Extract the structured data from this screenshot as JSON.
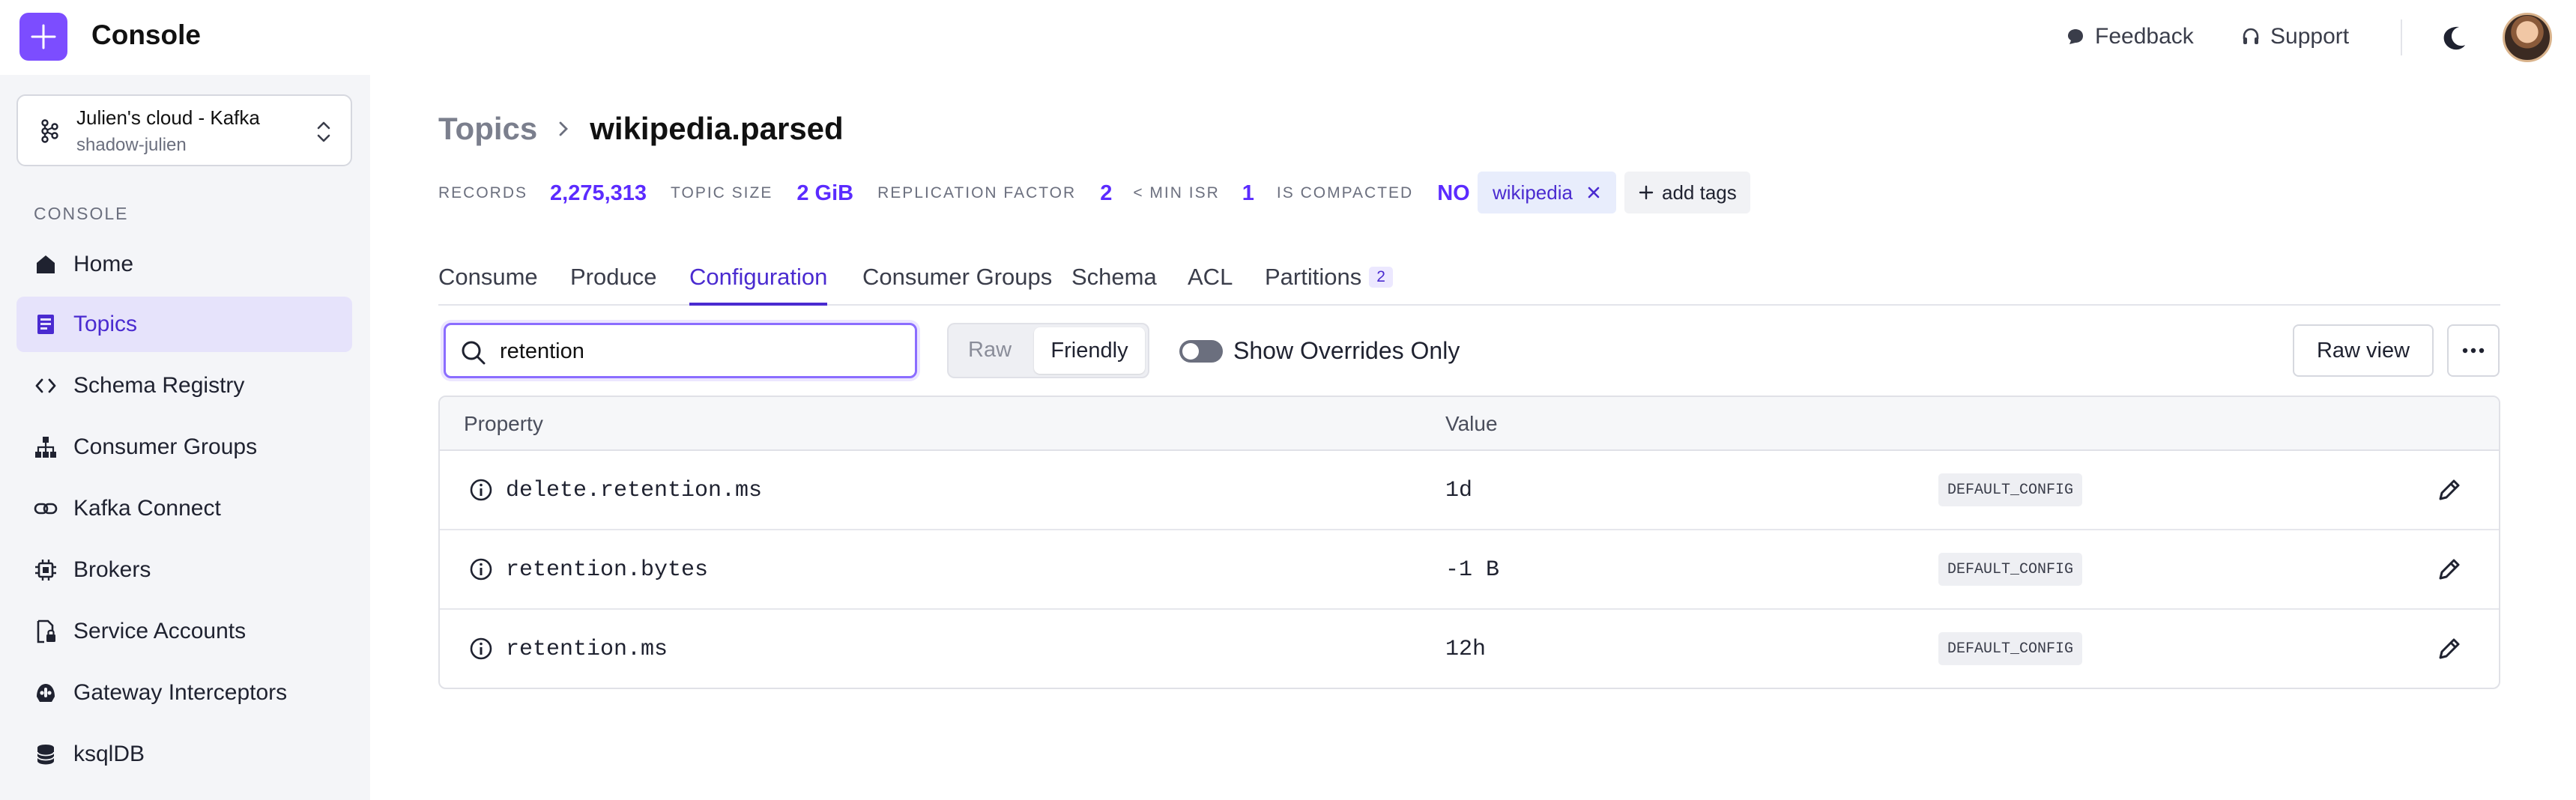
{
  "app": {
    "title": "Console"
  },
  "header": {
    "feedback": "Feedback",
    "support": "Support"
  },
  "sidebar": {
    "cluster_name": "Julien's cloud - Kafka",
    "cluster_sub": "shadow-julien",
    "section": "CONSOLE",
    "items": [
      {
        "label": "Home",
        "icon": "home-icon"
      },
      {
        "label": "Topics",
        "icon": "topics-icon",
        "active": true
      },
      {
        "label": "Schema Registry",
        "icon": "code-icon"
      },
      {
        "label": "Consumer Groups",
        "icon": "hierarchy-icon"
      },
      {
        "label": "Kafka Connect",
        "icon": "link-icon"
      },
      {
        "label": "Brokers",
        "icon": "cpu-icon"
      },
      {
        "label": "Service Accounts",
        "icon": "file-lock-icon"
      },
      {
        "label": "Gateway Interceptors",
        "icon": "gateway-icon"
      },
      {
        "label": "ksqlDB",
        "icon": "database-icon"
      }
    ]
  },
  "breadcrumb": {
    "parent": "Topics",
    "current": "wikipedia.parsed"
  },
  "stats": {
    "records_label": "RECORDS",
    "records": "2,275,313",
    "size_label": "TOPIC SIZE",
    "size": "2 GiB",
    "replication_label": "REPLICATION FACTOR",
    "replication": "2",
    "min_isr_label": "< MIN ISR",
    "min_isr": "1",
    "compacted_label": "IS COMPACTED",
    "compacted": "NO"
  },
  "tags": {
    "tag": "wikipedia",
    "add": "add tags"
  },
  "tabs": [
    {
      "label": "Consume"
    },
    {
      "label": "Produce"
    },
    {
      "label": "Configuration",
      "active": true
    },
    {
      "label": "Consumer Groups"
    },
    {
      "label": "Schema"
    },
    {
      "label": "ACL"
    },
    {
      "label": "Partitions",
      "badge": "2"
    }
  ],
  "toolbar": {
    "search_value": "retention",
    "seg_raw": "Raw",
    "seg_friendly": "Friendly",
    "overrides_label": "Show Overrides Only",
    "raw_view": "Raw view"
  },
  "table": {
    "col_property": "Property",
    "col_value": "Value",
    "rows": [
      {
        "property": "delete.retention.ms",
        "value": "1d",
        "source": "DEFAULT_CONFIG"
      },
      {
        "property": "retention.bytes",
        "value": "-1 B",
        "source": "DEFAULT_CONFIG"
      },
      {
        "property": "retention.ms",
        "value": "12h",
        "source": "DEFAULT_CONFIG"
      }
    ]
  },
  "colors": {
    "accent": "#4a2bd0",
    "logo": "#7c4dff",
    "stat": "#5b2bff"
  }
}
